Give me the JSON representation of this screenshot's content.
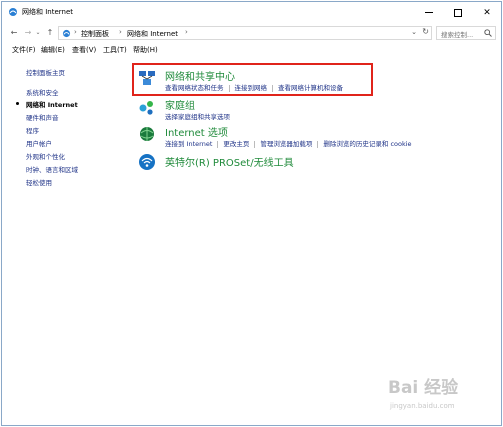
{
  "window": {
    "title": "网络和 Internet"
  },
  "navigation": {
    "breadcrumbs": [
      "控制面板",
      "网络和 Internet"
    ],
    "search_placeholder": "搜索控制..."
  },
  "menu": {
    "items": [
      "文件(F)",
      "编辑(E)",
      "查看(V)",
      "工具(T)",
      "帮助(H)"
    ]
  },
  "sidebar": {
    "items": [
      {
        "label": "控制面板主页",
        "active": false
      },
      {
        "label": "系统和安全",
        "active": false
      },
      {
        "label": "网络和 Internet",
        "active": true
      },
      {
        "label": "硬件和声音",
        "active": false
      },
      {
        "label": "程序",
        "active": false
      },
      {
        "label": "用户帐户",
        "active": false
      },
      {
        "label": "外观和个性化",
        "active": false
      },
      {
        "label": "时钟、语言和区域",
        "active": false
      },
      {
        "label": "轻松使用",
        "active": false
      }
    ]
  },
  "categories": [
    {
      "icon": "network-center-icon",
      "title": "网络和共享中心",
      "links": [
        "查看网络状态和任务",
        "连接到网络",
        "查看网络计算机和设备"
      ]
    },
    {
      "icon": "homegroup-icon",
      "title": "家庭组",
      "links": [
        "选择家庭组和共享选项"
      ]
    },
    {
      "icon": "internet-options-icon",
      "title": "Internet 选项",
      "links": [
        "连接到 Internet",
        "更改主页",
        "管理浏览器加载项",
        "删除浏览的历史记录和 cookie"
      ]
    },
    {
      "icon": "wireless-icon",
      "title": "英特尔(R) PROSet/无线工具",
      "links": []
    }
  ],
  "watermark": {
    "logo": "Bai 经验",
    "url": "jingyan.baidu.com"
  },
  "colors": {
    "link": "#1e3287",
    "category_title": "#1f8a3a",
    "highlight": "#e0241b"
  }
}
